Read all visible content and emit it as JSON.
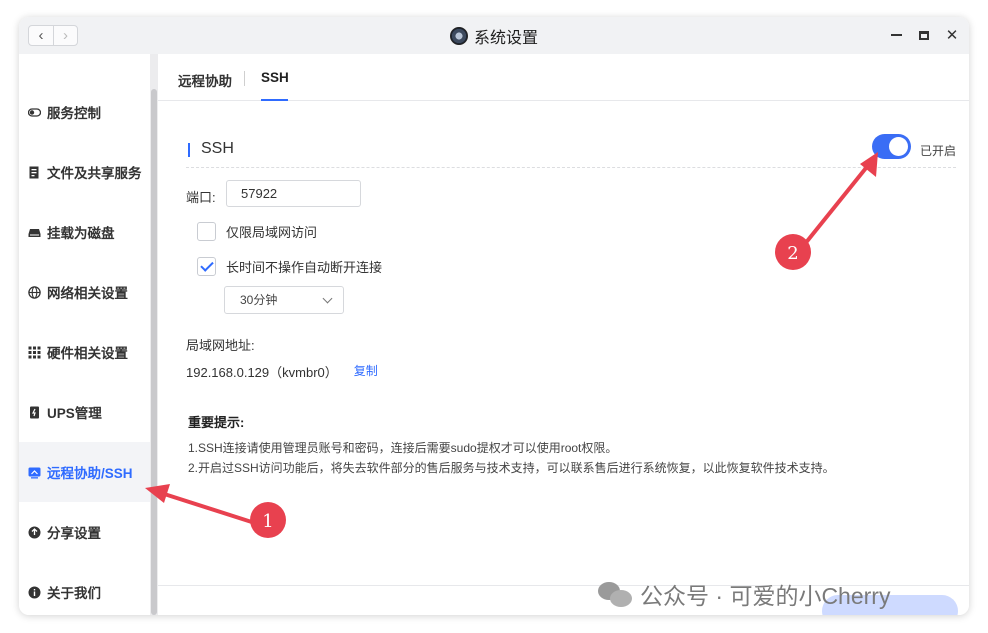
{
  "window": {
    "title": "系统设置",
    "nav_back_icon": "chevron-left-icon",
    "nav_forward_icon": "chevron-right-icon"
  },
  "sidebar": {
    "items": [
      {
        "label": "服务控制",
        "icon": "toggle-icon"
      },
      {
        "label": "文件及共享服务",
        "icon": "file-icon"
      },
      {
        "label": "挂载为磁盘",
        "icon": "disk-icon"
      },
      {
        "label": "网络相关设置",
        "icon": "globe-icon"
      },
      {
        "label": "硬件相关设置",
        "icon": "grid-icon"
      },
      {
        "label": "UPS管理",
        "icon": "ups-icon"
      },
      {
        "label": "远程协助/SSH",
        "icon": "remote-icon",
        "active": true
      },
      {
        "label": "分享设置",
        "icon": "share-icon"
      },
      {
        "label": "关于我们",
        "icon": "info-icon"
      }
    ]
  },
  "tabs": [
    {
      "label": "远程协助"
    },
    {
      "label": "SSH",
      "active": true
    }
  ],
  "ssh": {
    "section_title": "SSH",
    "toggle_on": true,
    "toggle_label": "已开启",
    "port_label": "端口:",
    "port_value": "57922",
    "lan_only_label": "仅限局域网访问",
    "lan_only_checked": false,
    "auto_disconnect_label": "长时间不操作自动断开连接",
    "auto_disconnect_checked": true,
    "timeout_value": "30分钟",
    "lan_address_label": "局域网地址:",
    "lan_address_value": "192.168.0.129（kvmbr0）",
    "copy_label": "复制"
  },
  "notice": {
    "title": "重要提示:",
    "line1": "1.SSH连接请使用管理员账号和密码，连接后需要sudo提权才可以使用root权限。",
    "line2": "2.开启过SSH访问功能后，将失去软件部分的售后服务与技术支持，可以联系售后进行系统恢复，以此恢复软件技术支持。"
  },
  "annotations": {
    "marker1": "1",
    "marker2": "2",
    "color": "#e8414f"
  },
  "watermark": {
    "text": "公众号 · 可爱的小Cherry"
  },
  "colors": {
    "accent": "#2f6bff",
    "toggle": "#3a6df5",
    "annotation": "#e8414f"
  }
}
